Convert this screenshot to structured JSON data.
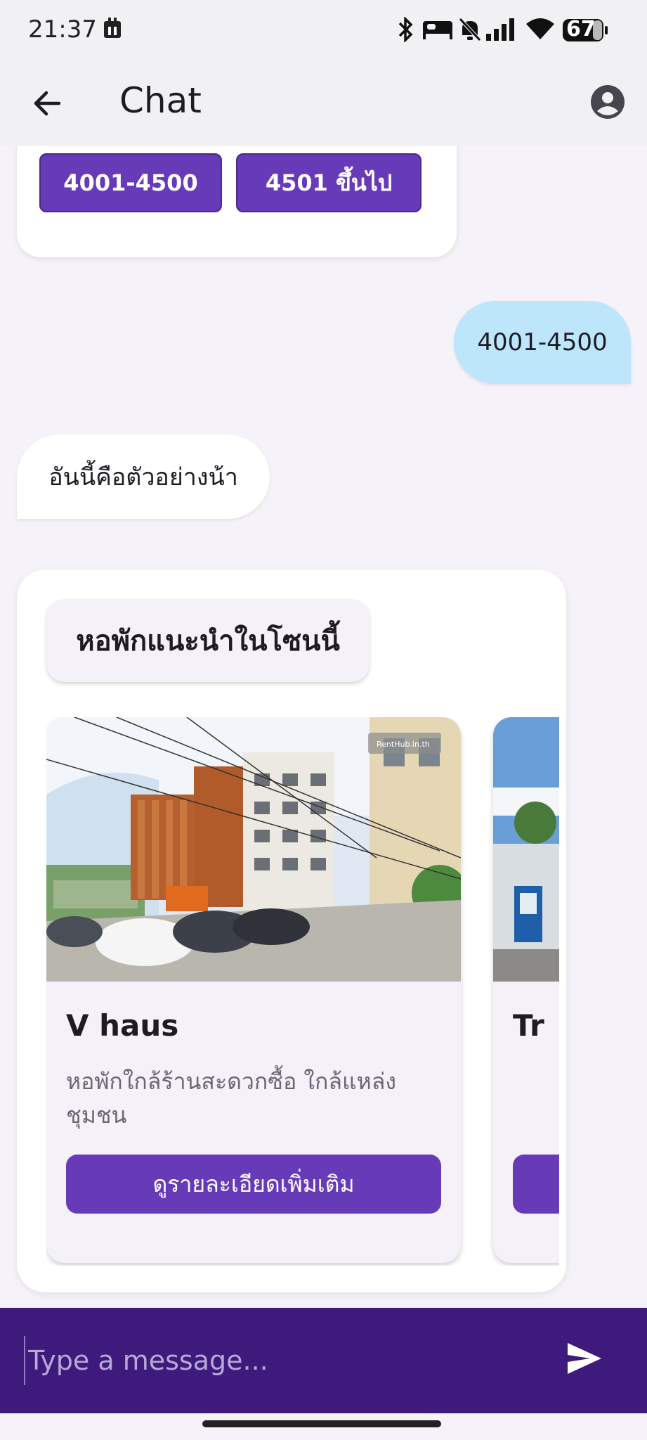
{
  "status_bar": {
    "time": "21:37",
    "battery": "67"
  },
  "app_bar": {
    "title": "Chat"
  },
  "price_options": [
    "4001-4500",
    "4501 ขึ้นไป"
  ],
  "messages": {
    "user_reply": "4001-4500",
    "bot_reply": "อันนี้คือตัวอย่างน้า"
  },
  "recommendations": {
    "heading": "หอพักแนะนำในโซนนี้",
    "cards": [
      {
        "name": "V haus",
        "description": "หอพักใกล้ร้านสะดวกซื้อ ใกล้แหล่งชุมชน",
        "button_label": "ดูรายละเอียดเพิ่มเติม",
        "image_watermark": "RentHub.in.th"
      },
      {
        "name": "Tr",
        "description": "",
        "button_label": ""
      }
    ]
  },
  "composer": {
    "placeholder": "Type a message..."
  },
  "colors": {
    "primary": "#673ab7",
    "user_bubble": "#bde6fb",
    "input_bar": "#3d1a7b"
  }
}
